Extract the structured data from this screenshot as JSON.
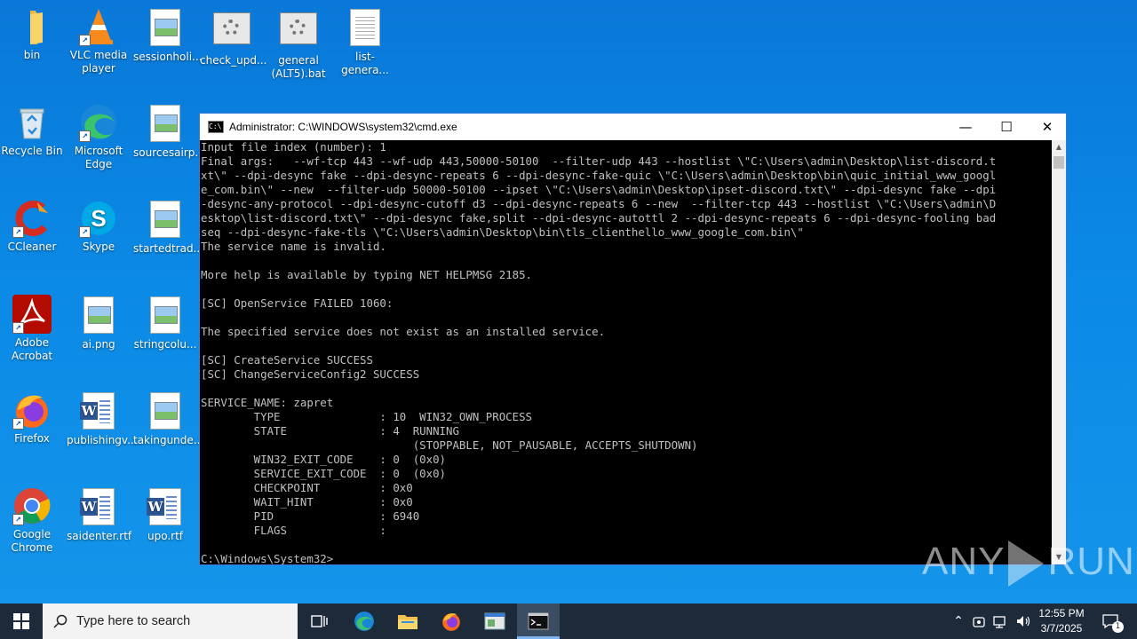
{
  "desktop": {
    "icons": [
      {
        "label": "bin"
      },
      {
        "label": "VLC media player"
      },
      {
        "label": "sessionholi..."
      },
      {
        "label": "check_upd..."
      },
      {
        "label": "general (ALT5).bat"
      },
      {
        "label": "list-genera..."
      },
      {
        "label": "Recycle Bin"
      },
      {
        "label": "Microsoft Edge"
      },
      {
        "label": "sourcesairp..."
      },
      {
        "label": "CCleaner"
      },
      {
        "label": "Skype"
      },
      {
        "label": "startedtrad..."
      },
      {
        "label": "Adobe Acrobat"
      },
      {
        "label": "ai.png"
      },
      {
        "label": "stringcolu..."
      },
      {
        "label": "Firefox"
      },
      {
        "label": "publishingv..."
      },
      {
        "label": "takingunde..."
      },
      {
        "label": "Google Chrome"
      },
      {
        "label": "saidenter.rtf"
      },
      {
        "label": "upo.rtf"
      }
    ]
  },
  "cmd": {
    "title": "Administrator: C:\\WINDOWS\\system32\\cmd.exe",
    "icon_text": "C:\\",
    "minimize": "—",
    "maximize": "☐",
    "close": "✕",
    "lines": [
      "Input file index (number): 1",
      "Final args:   --wf-tcp 443 --wf-udp 443,50000-50100  --filter-udp 443 --hostlist \\\"C:\\Users\\admin\\Desktop\\list-discord.t",
      "xt\\\" --dpi-desync fake --dpi-desync-repeats 6 --dpi-desync-fake-quic \\\"C:\\Users\\admin\\Desktop\\bin\\quic_initial_www_googl",
      "e_com.bin\\\" --new  --filter-udp 50000-50100 --ipset \\\"C:\\Users\\admin\\Desktop\\ipset-discord.txt\\\" --dpi-desync fake --dpi",
      "-desync-any-protocol --dpi-desync-cutoff d3 --dpi-desync-repeats 6 --new  --filter-tcp 443 --hostlist \\\"C:\\Users\\admin\\D",
      "esktop\\list-discord.txt\\\" --dpi-desync fake,split --dpi-desync-autottl 2 --dpi-desync-repeats 6 --dpi-desync-fooling bad",
      "seq --dpi-desync-fake-tls \\\"C:\\Users\\admin\\Desktop\\bin\\tls_clienthello_www_google_com.bin\\\"",
      "The service name is invalid.",
      "",
      "More help is available by typing NET HELPMSG 2185.",
      "",
      "[SC] OpenService FAILED 1060:",
      "",
      "The specified service does not exist as an installed service.",
      "",
      "[SC] CreateService SUCCESS",
      "[SC] ChangeServiceConfig2 SUCCESS",
      "",
      "SERVICE_NAME: zapret",
      "        TYPE               : 10  WIN32_OWN_PROCESS",
      "        STATE              : 4  RUNNING",
      "                                (STOPPABLE, NOT_PAUSABLE, ACCEPTS_SHUTDOWN)",
      "        WIN32_EXIT_CODE    : 0  (0x0)",
      "        SERVICE_EXIT_CODE  : 0  (0x0)",
      "        CHECKPOINT         : 0x0",
      "        WAIT_HINT          : 0x0",
      "        PID                : 6940",
      "        FLAGS              :",
      "",
      "C:\\Windows\\System32>"
    ]
  },
  "watermark": {
    "left": "ANY",
    "right": "RUN"
  },
  "taskbar": {
    "search_placeholder": "Type here to search",
    "clock_time": "12:55 PM",
    "clock_date": "3/7/2025",
    "notification_count": "1"
  }
}
